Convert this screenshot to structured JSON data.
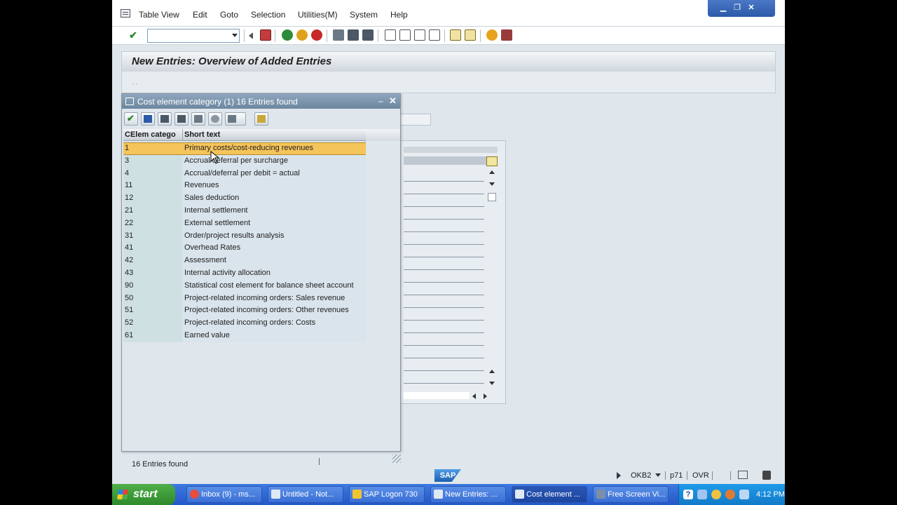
{
  "menubar": {
    "items": [
      "Table View",
      "Edit",
      "Goto",
      "Selection",
      "Utilities(M)",
      "System",
      "Help"
    ]
  },
  "toolbar": {
    "command_value": ""
  },
  "screen": {
    "title": "New Entries: Overview of Added Entries",
    "dots": ". ."
  },
  "popup": {
    "title": "Cost element category (1)   16 Entries found",
    "columns": [
      "CElem catego",
      "Short text"
    ],
    "rows": [
      {
        "code": "1",
        "text": "Primary costs/cost-reducing revenues",
        "selected": true
      },
      {
        "code": "3",
        "text": "Accrual/deferral per surcharge"
      },
      {
        "code": "4",
        "text": "Accrual/deferral per debit = actual"
      },
      {
        "code": "11",
        "text": "Revenues"
      },
      {
        "code": "12",
        "text": "Sales deduction"
      },
      {
        "code": "21",
        "text": "Internal settlement"
      },
      {
        "code": "22",
        "text": "External settlement"
      },
      {
        "code": "31",
        "text": "Order/project results analysis"
      },
      {
        "code": "41",
        "text": "Overhead Rates"
      },
      {
        "code": "42",
        "text": "Assessment"
      },
      {
        "code": "43",
        "text": "Internal activity allocation"
      },
      {
        "code": "90",
        "text": "Statistical cost element for balance sheet account"
      },
      {
        "code": "50",
        "text": "Project-related incoming orders: Sales revenue"
      },
      {
        "code": "51",
        "text": "Project-related incoming orders: Other revenues"
      },
      {
        "code": "52",
        "text": "Project-related incoming orders: Costs"
      },
      {
        "code": "61",
        "text": "Earned value"
      }
    ],
    "status": "16 Entries found"
  },
  "statusbar": {
    "transaction": "OKB2",
    "server": "p71",
    "mode": "OVR",
    "sap_logo": "SAP"
  },
  "taskbar": {
    "start": "start",
    "tasks": [
      "Inbox (9) - ms...",
      "Untitled - Not...",
      "SAP Logon 730",
      "New Entries: ...",
      "Cost element ...",
      "Free Screen Vi..."
    ],
    "clock": "4:12 PM"
  },
  "colors": {
    "selected_row": "#f5c45a",
    "code_cell": "#cfe0e2",
    "text_cell": "#d9e4ec",
    "taskbar": "#2457c6",
    "start_green": "#3c9a36"
  }
}
